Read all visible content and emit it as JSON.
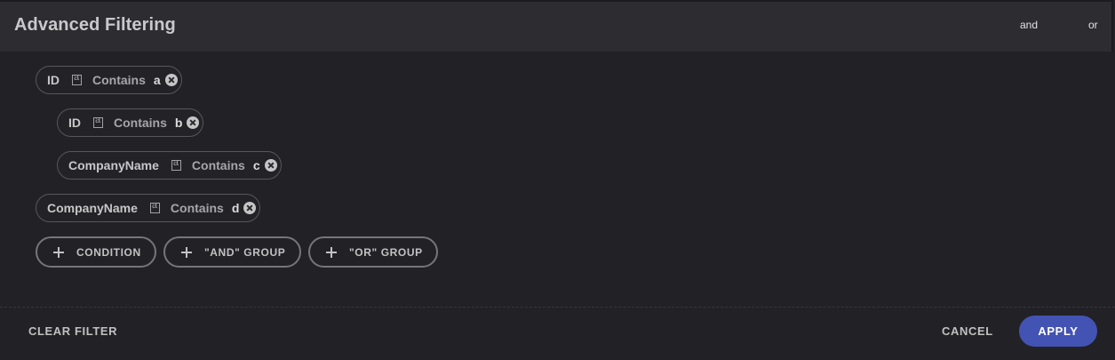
{
  "header": {
    "title": "Advanced Filtering",
    "logic_and": "and",
    "logic_or": "or"
  },
  "conditions": [
    {
      "field": "ID",
      "operator_icon": "string-operand-icon",
      "condition": "Contains",
      "value": "a"
    },
    {
      "field": "ID",
      "operator_icon": "string-operand-icon",
      "condition": "Contains",
      "value": "b"
    },
    {
      "field": "CompanyName",
      "operator_icon": "string-operand-icon",
      "condition": "Contains",
      "value": "c"
    },
    {
      "field": "CompanyName",
      "operator_icon": "string-operand-icon",
      "condition": "Contains",
      "value": "d"
    }
  ],
  "add_buttons": {
    "condition": "CONDITION",
    "and_group": "\"AND\" GROUP",
    "or_group": "\"OR\" GROUP"
  },
  "footer": {
    "clear_filter": "CLEAR FILTER",
    "cancel": "CANCEL",
    "apply": "APPLY"
  },
  "colors": {
    "background": "#222226",
    "header_background": "#2c2c31",
    "accent": "#4353b3"
  }
}
